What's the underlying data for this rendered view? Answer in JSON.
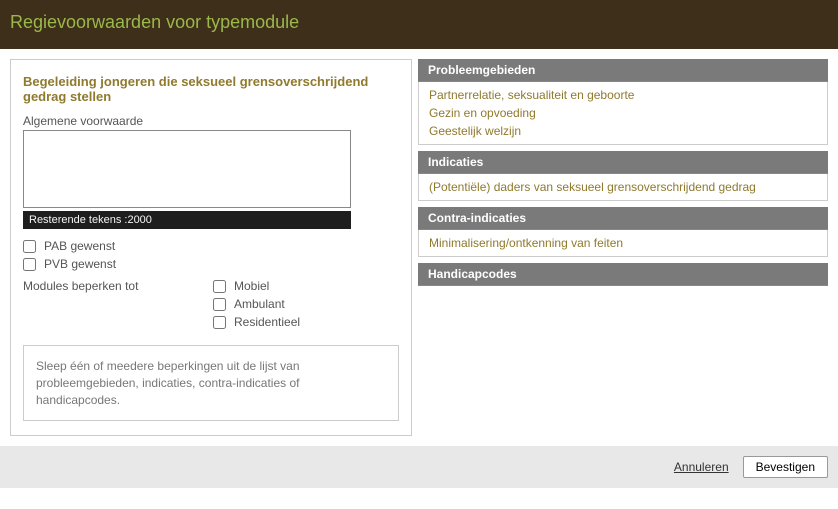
{
  "header": {
    "title": "Regievoorwaarden voor typemodule"
  },
  "form": {
    "title": "Begeleiding jongeren die seksueel grensoverschrijdend gedrag stellen",
    "general_conditions_label": "Algemene voorwaarde",
    "general_conditions_value": "",
    "char_counter": "Resterende tekens :2000",
    "pab_label": "PAB gewenst",
    "pvb_label": "PVB gewenst",
    "restrict_label": "Modules beperken tot",
    "restrict_opts": {
      "mobiel": "Mobiel",
      "ambulant": "Ambulant",
      "residentieel": "Residentieel"
    },
    "dropzone_text": "Sleep één of meedere beperkingen uit de lijst van probleemgebieden, indicaties, contra-indicaties of handicapcodes."
  },
  "sections": {
    "problem_areas": {
      "title": "Probleemgebieden",
      "items": [
        "Partnerrelatie, seksualiteit en geboorte",
        "Gezin en opvoeding",
        "Geestelijk welzijn"
      ]
    },
    "indications": {
      "title": "Indicaties",
      "items": [
        "(Potentiële) daders van seksueel grensoverschrijdend gedrag"
      ]
    },
    "contra": {
      "title": "Contra-indicaties",
      "items": [
        "Minimalisering/ontkenning van feiten"
      ]
    },
    "handicap": {
      "title": "Handicapcodes",
      "items": []
    }
  },
  "footer": {
    "cancel": "Annuleren",
    "confirm": "Bevestigen"
  }
}
